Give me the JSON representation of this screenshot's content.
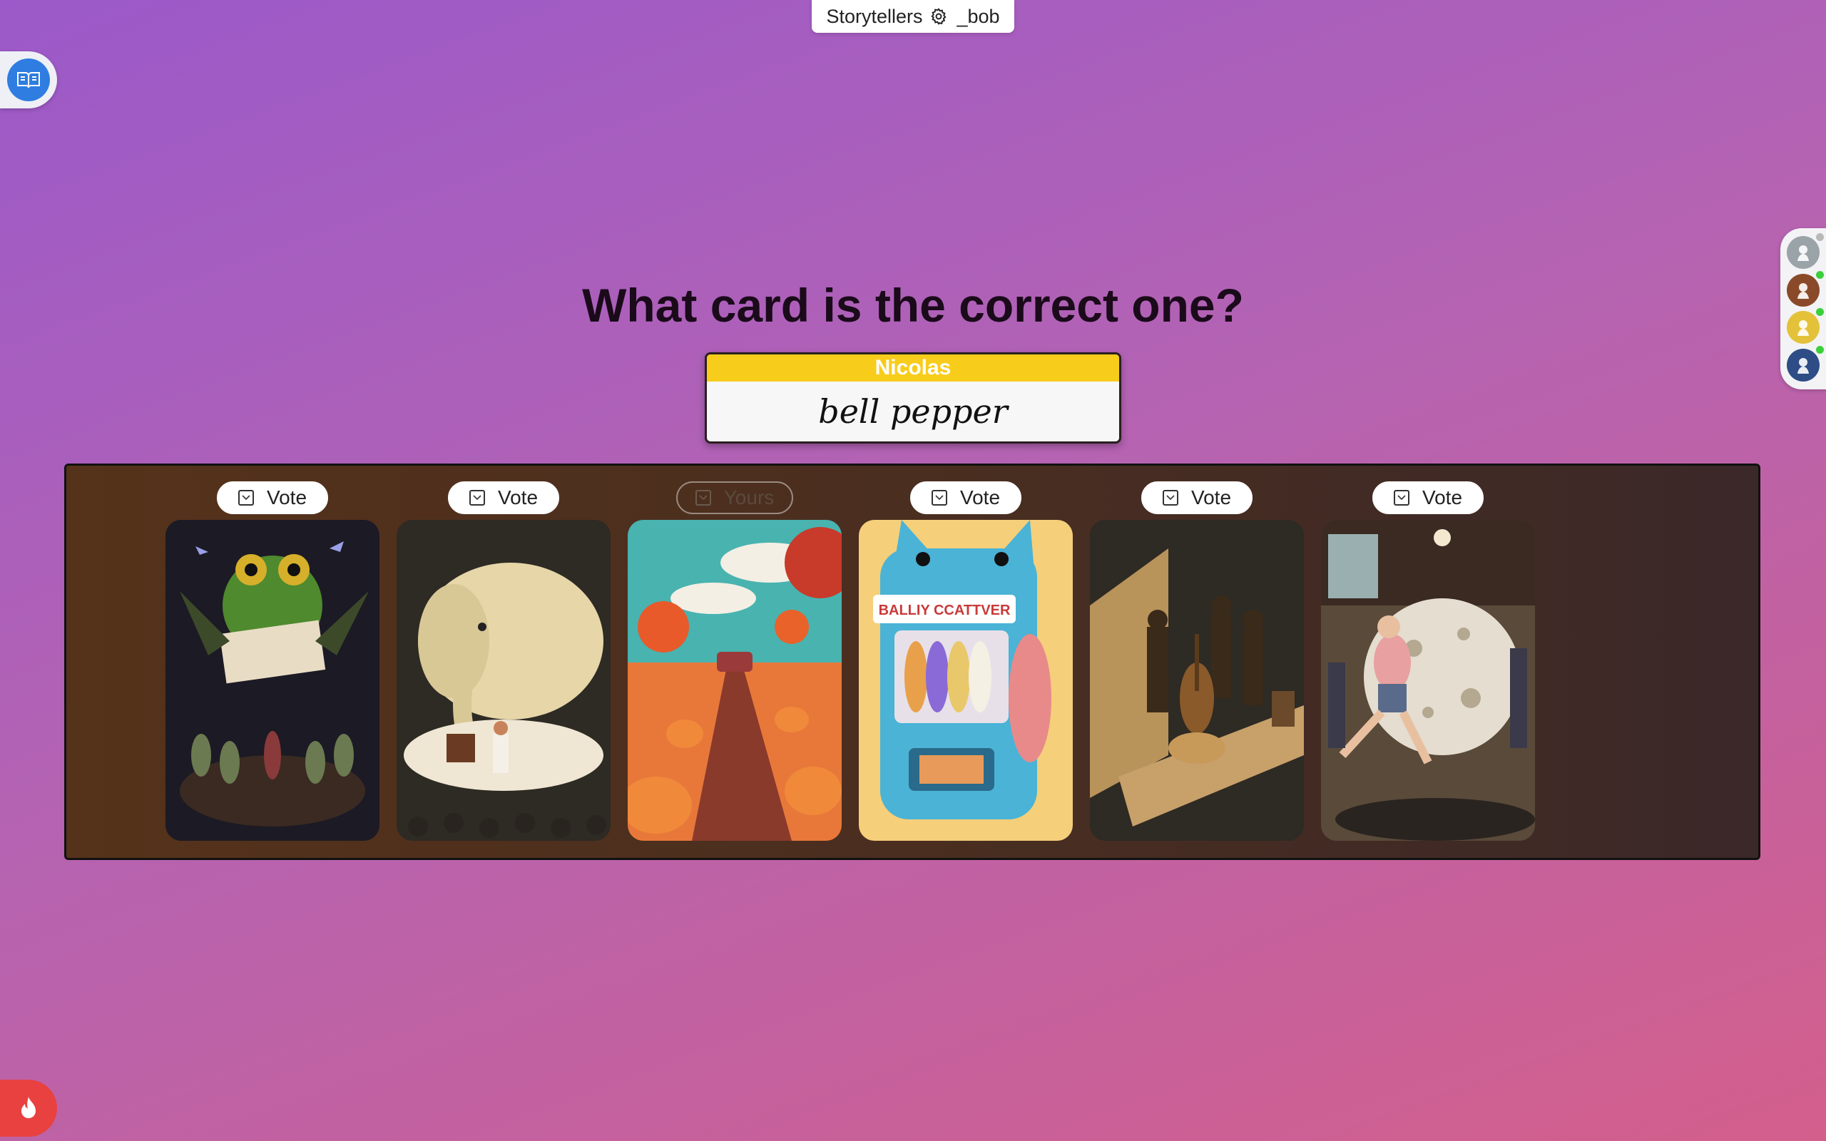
{
  "topbar": {
    "game_name": "Storytellers",
    "username": "_bob"
  },
  "icons": {
    "rules": "book-icon",
    "settings": "gear-icon",
    "fire": "fire-icon",
    "checkbox": "checkbox-icon"
  },
  "players": [
    {
      "avatar": "seahorse-avatar",
      "color": "#9aa3a8",
      "online_color": "#b9b9b9"
    },
    {
      "avatar": "dog-avatar",
      "color": "#8a4a2a",
      "online_color": "#3ccf3c"
    },
    {
      "avatar": "bird-avatar",
      "color": "#e3c23a",
      "online_color": "#3ccf3c"
    },
    {
      "avatar": "squid-avatar",
      "color": "#2e4d86",
      "online_color": "#3ccf3c"
    }
  ],
  "prompt": {
    "title": "What card is the correct one?"
  },
  "clue": {
    "storyteller": "Nicolas",
    "word": "bell pepper"
  },
  "cards": [
    {
      "button_label": "Vote",
      "own": false,
      "image": "frog-reading-book"
    },
    {
      "button_label": "Vote",
      "own": false,
      "image": "elephant-on-cake"
    },
    {
      "button_label": "Yours",
      "own": true,
      "image": "pumpkin-field-road"
    },
    {
      "button_label": "Vote",
      "own": false,
      "image": "cat-vending-machine",
      "text_on_image": "BALLIY CCATTVER"
    },
    {
      "button_label": "Vote",
      "own": false,
      "image": "jazz-band-diorama"
    },
    {
      "button_label": "Vote",
      "own": false,
      "image": "person-kicking-giant-ball"
    }
  ],
  "colors": {
    "accent_yellow": "#f8cc1b",
    "rules_blue": "#2f7de1",
    "fire_red": "#e8413f",
    "board_brown": "#4a2e20"
  }
}
